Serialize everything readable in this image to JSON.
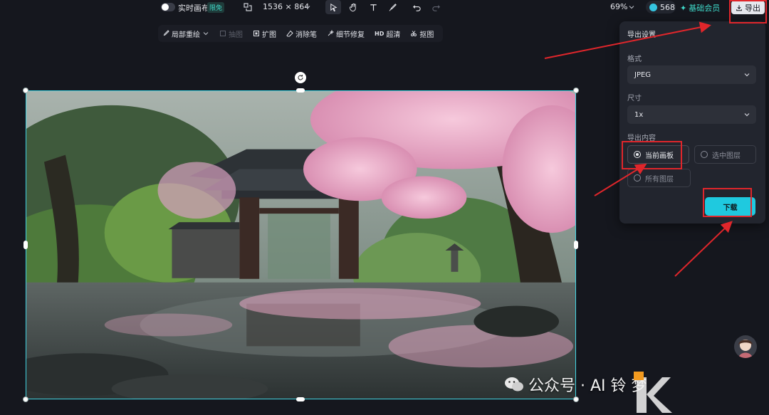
{
  "topbar": {
    "realtime_label": "实时画布",
    "realtime_badge": "限免",
    "canvas_size": "1536 × 864",
    "zoom": "69%",
    "credits": "568",
    "member": "基础会员",
    "export_label": "导出"
  },
  "subtoolbar": {
    "items": [
      {
        "label": "局部重绘",
        "icon": "brush-icon"
      },
      {
        "label": "抽图",
        "icon": "crop-icon"
      },
      {
        "label": "扩图",
        "icon": "expand-icon"
      },
      {
        "label": "消除笔",
        "icon": "eraser-icon"
      },
      {
        "label": "细节修复",
        "icon": "sparkle-icon"
      },
      {
        "label": "超清",
        "icon": "hd-icon"
      },
      {
        "label": "抠图",
        "icon": "cutout-icon"
      }
    ],
    "hd_prefix": "HD"
  },
  "export_panel": {
    "title": "导出设置",
    "format_label": "格式",
    "format_value": "JPEG",
    "size_label": "尺寸",
    "size_value": "1x",
    "content_label": "导出内容",
    "options": [
      "当前画板",
      "选中图层",
      "所有图层"
    ],
    "selected_option": "当前画板",
    "download_label": "下载"
  },
  "watermark": {
    "text": "公众号 · AI 铃 梦 "
  },
  "colors": {
    "accent": "#1fc9df",
    "selection": "#43d6e4",
    "highlight": "#e0262b",
    "background": "#15171e",
    "panel": "#22252e"
  }
}
